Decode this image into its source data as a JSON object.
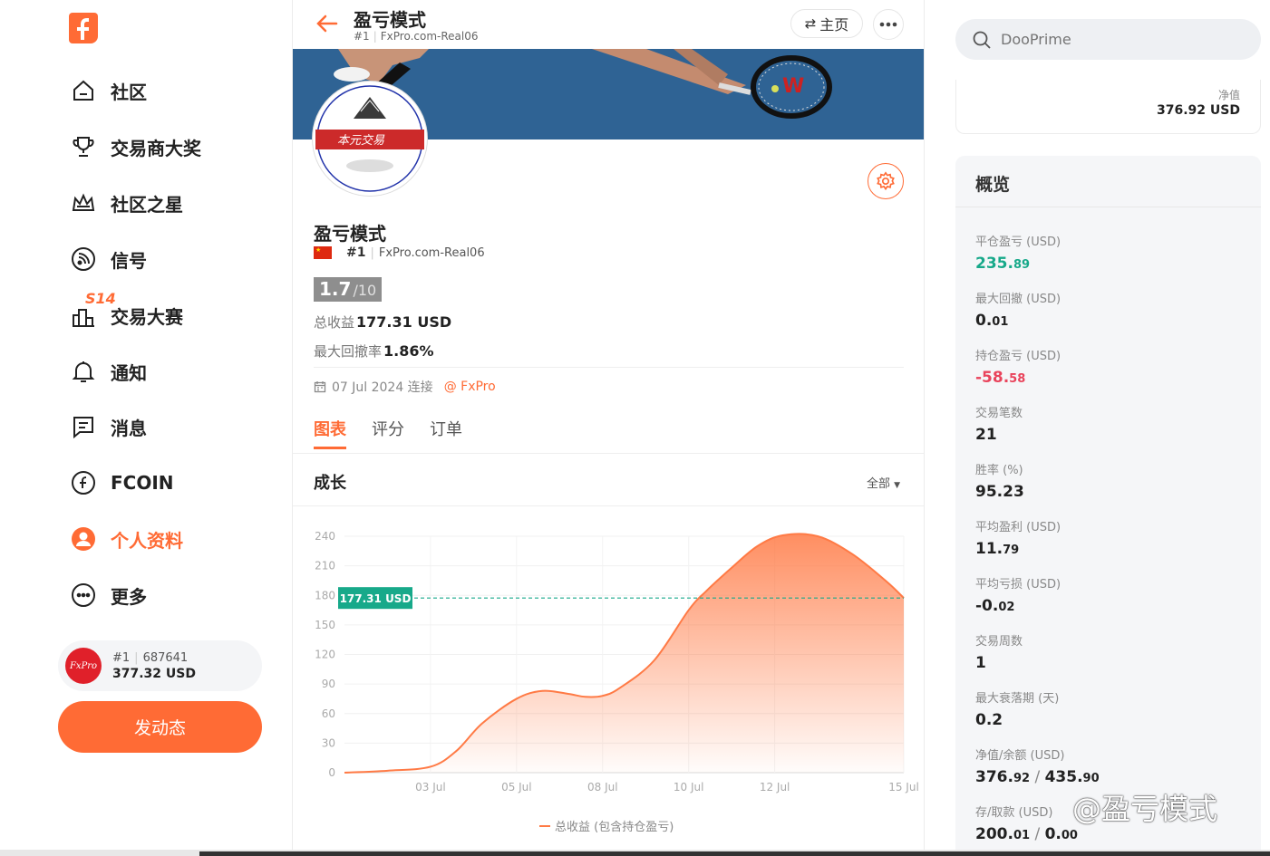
{
  "nav": {
    "items": [
      {
        "label": "社区",
        "icon": "home-icon"
      },
      {
        "label": "交易商大奖",
        "icon": "trophy-icon"
      },
      {
        "label": "社区之星",
        "icon": "crown-icon"
      },
      {
        "label": "信号",
        "icon": "signal-icon"
      },
      {
        "label": "交易大赛",
        "icon": "contest-icon",
        "badge": "S14"
      },
      {
        "label": "通知",
        "icon": "bell-icon"
      },
      {
        "label": "消息",
        "icon": "message-icon"
      },
      {
        "label": "FCOIN",
        "icon": "fcoin-icon"
      },
      {
        "label": "个人资料",
        "icon": "profile-icon",
        "active": true
      },
      {
        "label": "更多",
        "icon": "more-icon"
      }
    ],
    "account": {
      "broker_logo": "FxPro",
      "rank": "#1",
      "id": "687641",
      "balance": "377.32 USD"
    },
    "post_button": "发动态"
  },
  "topbar": {
    "title": "盈亏模式",
    "rank": "#1",
    "account": "FxPro.com-Real06",
    "home_label": "主页"
  },
  "profile": {
    "avatar_text": "本元交易",
    "name": "盈亏模式",
    "rank": "#1",
    "account": "FxPro.com-Real06",
    "score": "1.7",
    "score_total": "/10",
    "total_profit_label": "总收益",
    "total_profit_value": "177.31 USD",
    "max_drawdown_label": "最大回撤率",
    "max_drawdown_value": "1.86%",
    "connected": "07 Jul 2024 连接",
    "broker": "@ FxPro"
  },
  "tabs": [
    "图表",
    "评分",
    "订单"
  ],
  "chart_section": {
    "title": "成长",
    "filter": "全部"
  },
  "chart_data": {
    "type": "area",
    "title": "",
    "x_ticks": [
      "03 Jul",
      "05 Jul",
      "08 Jul",
      "10 Jul",
      "12 Jul",
      "15 Jul"
    ],
    "ylim": [
      0,
      240
    ],
    "y_ticks": [
      0,
      30,
      60,
      90,
      120,
      150,
      180,
      210,
      240
    ],
    "series": [
      {
        "name": "总收益 (包含持仓盈亏)",
        "color": "#ff7a45",
        "points": [
          {
            "x": 0.0,
            "y": 0
          },
          {
            "x": 0.5,
            "y": 2
          },
          {
            "x": 1.0,
            "y": 6
          },
          {
            "x": 1.3,
            "y": 22
          },
          {
            "x": 1.6,
            "y": 50
          },
          {
            "x": 2.0,
            "y": 75
          },
          {
            "x": 2.3,
            "y": 83
          },
          {
            "x": 2.6,
            "y": 80
          },
          {
            "x": 2.8,
            "y": 77
          },
          {
            "x": 3.0,
            "y": 78
          },
          {
            "x": 3.2,
            "y": 86
          },
          {
            "x": 3.6,
            "y": 114
          },
          {
            "x": 4.0,
            "y": 165
          },
          {
            "x": 4.2,
            "y": 184
          },
          {
            "x": 4.5,
            "y": 208
          },
          {
            "x": 4.8,
            "y": 230
          },
          {
            "x": 5.1,
            "y": 241
          },
          {
            "x": 5.5,
            "y": 240
          },
          {
            "x": 5.9,
            "y": 222
          },
          {
            "x": 6.3,
            "y": 194
          },
          {
            "x": 6.5,
            "y": 177.31
          }
        ]
      }
    ],
    "reference_line": {
      "value": 177.31,
      "label": "177.31 USD",
      "color": "#17a98a"
    },
    "legend_position": "bottom-center",
    "grid": true
  },
  "right": {
    "search_placeholder": "DooPrime",
    "networth_label": "净值",
    "networth_value": "376.92 USD",
    "overview_title": "概览",
    "overview": [
      {
        "label": "平仓盈亏 (USD)",
        "main": "235.",
        "decimals": "89",
        "tone": "pos"
      },
      {
        "label": "最大回撤 (USD)",
        "main": "0.",
        "decimals": "01",
        "tone": ""
      },
      {
        "label": "持仓盈亏 (USD)",
        "main": "-58.",
        "decimals": "58",
        "tone": "neg"
      },
      {
        "label": "交易笔数",
        "main": "21",
        "decimals": "",
        "tone": ""
      },
      {
        "label": "胜率 (%)",
        "main": "95.23",
        "decimals": "",
        "tone": ""
      },
      {
        "label": "平均盈利 (USD)",
        "main": "11.",
        "decimals": "79",
        "tone": ""
      },
      {
        "label": "平均亏损 (USD)",
        "main": "-0.",
        "decimals": "02",
        "tone": ""
      },
      {
        "label": "交易周数",
        "main": "1",
        "decimals": "",
        "tone": ""
      },
      {
        "label": "最大衰落期 (天)",
        "main": "0.2",
        "decimals": "",
        "tone": ""
      },
      {
        "label": "净值/余额 (USD)",
        "main": "376.",
        "decimals": "92",
        "main2": "435.",
        "decimals2": "90",
        "tone": ""
      },
      {
        "label": "存/取款 (USD)",
        "main": "200.",
        "decimals": "01",
        "main2": "0.",
        "decimals2": "00",
        "tone": ""
      }
    ]
  },
  "watermark": "@盈亏模式",
  "colors": {
    "accent": "#ff6b35",
    "positive": "#17a98a",
    "negative": "#e9435b"
  }
}
